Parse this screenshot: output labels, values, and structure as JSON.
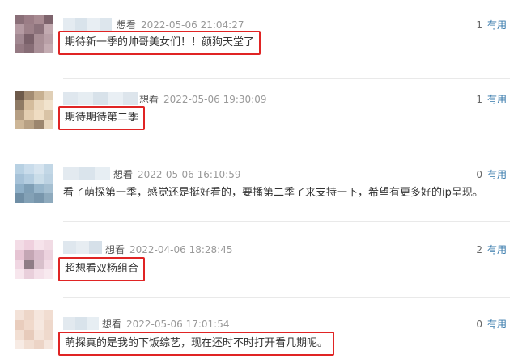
{
  "comments": [
    {
      "action": "想看",
      "time": "2022-05-06 21:04:27",
      "text": "期待新一季的帅哥美女们！！颜狗天堂了",
      "count": "1",
      "useful_label": "有用",
      "avatar_colors": [
        "#8a6f78",
        "#9b7d86",
        "#a88b92",
        "#7e646d",
        "#b49aa2",
        "#9d8189",
        "#8c727b",
        "#c2aab0",
        "#a18891",
        "#7a616a",
        "#a98f96",
        "#b9a0a7",
        "#957a83",
        "#876d76",
        "#aa9098",
        "#c4acb2"
      ]
    },
    {
      "action": "想看",
      "time": "2022-05-06 19:30:09",
      "text": "期待期待第二季",
      "count": "1",
      "useful_label": "有用",
      "avatar_colors": [
        "#6d5a4a",
        "#a38c72",
        "#c7b091",
        "#e0cfb6",
        "#8e7a64",
        "#d4bc9c",
        "#e9d7bd",
        "#f1e3cd",
        "#b59e83",
        "#e3cdb0",
        "#efdcc2",
        "#d9c3a6",
        "#cdb697",
        "#b8a184",
        "#9c866e",
        "#e8d6bc"
      ]
    },
    {
      "action": "想看",
      "time": "2022-05-06 16:10:59",
      "text": "看了萌探第一季，感觉还是挺好看的，要播第二季了来支持一下，希望有更多好的ip呈现。",
      "count": "0",
      "useful_label": "有用",
      "avatar_colors": [
        "#b8d1e3",
        "#c9dceb",
        "#d6e4ef",
        "#c2d7e6",
        "#a6c2d8",
        "#b4cde0",
        "#cadde9",
        "#bcd2e2",
        "#8fb0c8",
        "#7f9fb6",
        "#98b6cb",
        "#a5bfd1",
        "#6f8ea5",
        "#83a1b6",
        "#7896ac",
        "#8eaabd"
      ]
    },
    {
      "action": "想看",
      "time": "2022-04-06 18:28:45",
      "text": "超想看双杨组合",
      "count": "2",
      "useful_label": "有用",
      "avatar_colors": [
        "#f3dce6",
        "#efd0de",
        "#f6e3eb",
        "#f1dbe4",
        "#e6c4d3",
        "#c4a6b4",
        "#d9bccb",
        "#ecd2de",
        "#f0d6e2",
        "#8f7d86",
        "#d8c0cb",
        "#f2dbe5",
        "#f7e6ed",
        "#e9cfdb",
        "#f4e0e9",
        "#f8e9ef"
      ]
    },
    {
      "action": "想看",
      "time": "2022-05-06 17:01:54",
      "text": "萌探真的是我的下饭综艺，现在还时不时打开看几期呢。",
      "count": "0",
      "useful_label": "有用",
      "avatar_colors": [
        "#f3e2d8",
        "#edd6c8",
        "#f5e6dd",
        "#f1ddd1",
        "#e9cdbd",
        "#f0d9cb",
        "#f6e8e0",
        "#eed8cb",
        "#f2dfd3",
        "#e7cbbb",
        "#f4e3d9",
        "#efd9cc",
        "#f7ebe4",
        "#f1ded2",
        "#ecd4c6",
        "#f5e6dd"
      ]
    }
  ]
}
